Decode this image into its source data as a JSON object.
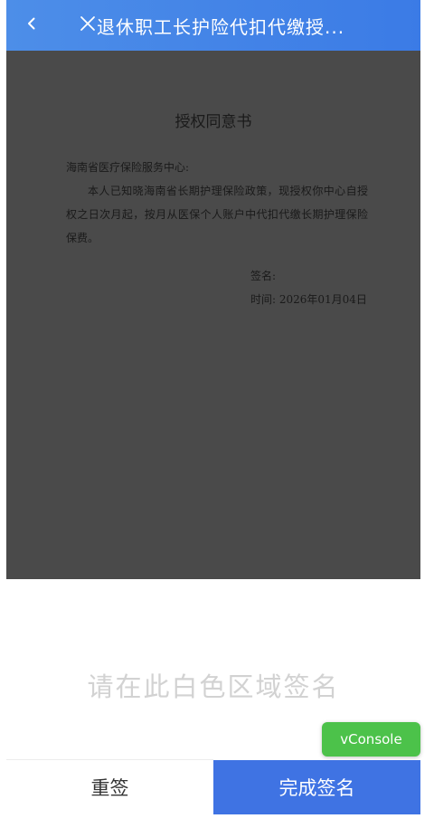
{
  "header": {
    "title": "退休职工长护险代扣代缴授..."
  },
  "document": {
    "title": "授权同意书",
    "addressee": "海南省医疗保险服务中心:",
    "body": "本人已知晓海南省长期护理保险政策，现授权你中心自授权之日次月起，按月从医保个人账户中代扣代缴长期护理保险保费。",
    "sign_label": "签名:",
    "time_label": "时间: 2026年01月04日"
  },
  "signature_area": {
    "hint": "请在此白色区域签名"
  },
  "vconsole": {
    "label": "vConsole"
  },
  "footer": {
    "resign_label": "重签",
    "finish_label": "完成签名"
  },
  "colors": {
    "header_bg": "#4d8ee8",
    "document_bg": "#4a4a4a",
    "finish_button_bg": "#3f73e3",
    "vconsole_bg": "#4cc24a",
    "hint_text": "#d2d2d2"
  }
}
